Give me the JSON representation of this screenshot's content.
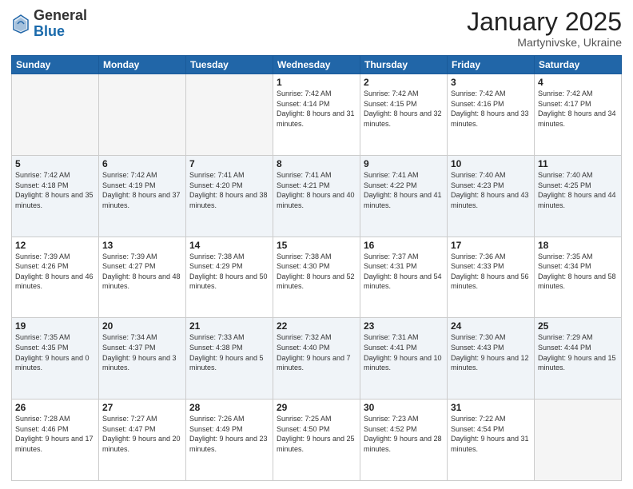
{
  "logo": {
    "general": "General",
    "blue": "Blue"
  },
  "title": "January 2025",
  "subtitle": "Martynivske, Ukraine",
  "days_header": [
    "Sunday",
    "Monday",
    "Tuesday",
    "Wednesday",
    "Thursday",
    "Friday",
    "Saturday"
  ],
  "weeks": [
    [
      {
        "day": "",
        "info": ""
      },
      {
        "day": "",
        "info": ""
      },
      {
        "day": "",
        "info": ""
      },
      {
        "day": "1",
        "info": "Sunrise: 7:42 AM\nSunset: 4:14 PM\nDaylight: 8 hours and 31 minutes."
      },
      {
        "day": "2",
        "info": "Sunrise: 7:42 AM\nSunset: 4:15 PM\nDaylight: 8 hours and 32 minutes."
      },
      {
        "day": "3",
        "info": "Sunrise: 7:42 AM\nSunset: 4:16 PM\nDaylight: 8 hours and 33 minutes."
      },
      {
        "day": "4",
        "info": "Sunrise: 7:42 AM\nSunset: 4:17 PM\nDaylight: 8 hours and 34 minutes."
      }
    ],
    [
      {
        "day": "5",
        "info": "Sunrise: 7:42 AM\nSunset: 4:18 PM\nDaylight: 8 hours and 35 minutes."
      },
      {
        "day": "6",
        "info": "Sunrise: 7:42 AM\nSunset: 4:19 PM\nDaylight: 8 hours and 37 minutes."
      },
      {
        "day": "7",
        "info": "Sunrise: 7:41 AM\nSunset: 4:20 PM\nDaylight: 8 hours and 38 minutes."
      },
      {
        "day": "8",
        "info": "Sunrise: 7:41 AM\nSunset: 4:21 PM\nDaylight: 8 hours and 40 minutes."
      },
      {
        "day": "9",
        "info": "Sunrise: 7:41 AM\nSunset: 4:22 PM\nDaylight: 8 hours and 41 minutes."
      },
      {
        "day": "10",
        "info": "Sunrise: 7:40 AM\nSunset: 4:23 PM\nDaylight: 8 hours and 43 minutes."
      },
      {
        "day": "11",
        "info": "Sunrise: 7:40 AM\nSunset: 4:25 PM\nDaylight: 8 hours and 44 minutes."
      }
    ],
    [
      {
        "day": "12",
        "info": "Sunrise: 7:39 AM\nSunset: 4:26 PM\nDaylight: 8 hours and 46 minutes."
      },
      {
        "day": "13",
        "info": "Sunrise: 7:39 AM\nSunset: 4:27 PM\nDaylight: 8 hours and 48 minutes."
      },
      {
        "day": "14",
        "info": "Sunrise: 7:38 AM\nSunset: 4:29 PM\nDaylight: 8 hours and 50 minutes."
      },
      {
        "day": "15",
        "info": "Sunrise: 7:38 AM\nSunset: 4:30 PM\nDaylight: 8 hours and 52 minutes."
      },
      {
        "day": "16",
        "info": "Sunrise: 7:37 AM\nSunset: 4:31 PM\nDaylight: 8 hours and 54 minutes."
      },
      {
        "day": "17",
        "info": "Sunrise: 7:36 AM\nSunset: 4:33 PM\nDaylight: 8 hours and 56 minutes."
      },
      {
        "day": "18",
        "info": "Sunrise: 7:35 AM\nSunset: 4:34 PM\nDaylight: 8 hours and 58 minutes."
      }
    ],
    [
      {
        "day": "19",
        "info": "Sunrise: 7:35 AM\nSunset: 4:35 PM\nDaylight: 9 hours and 0 minutes."
      },
      {
        "day": "20",
        "info": "Sunrise: 7:34 AM\nSunset: 4:37 PM\nDaylight: 9 hours and 3 minutes."
      },
      {
        "day": "21",
        "info": "Sunrise: 7:33 AM\nSunset: 4:38 PM\nDaylight: 9 hours and 5 minutes."
      },
      {
        "day": "22",
        "info": "Sunrise: 7:32 AM\nSunset: 4:40 PM\nDaylight: 9 hours and 7 minutes."
      },
      {
        "day": "23",
        "info": "Sunrise: 7:31 AM\nSunset: 4:41 PM\nDaylight: 9 hours and 10 minutes."
      },
      {
        "day": "24",
        "info": "Sunrise: 7:30 AM\nSunset: 4:43 PM\nDaylight: 9 hours and 12 minutes."
      },
      {
        "day": "25",
        "info": "Sunrise: 7:29 AM\nSunset: 4:44 PM\nDaylight: 9 hours and 15 minutes."
      }
    ],
    [
      {
        "day": "26",
        "info": "Sunrise: 7:28 AM\nSunset: 4:46 PM\nDaylight: 9 hours and 17 minutes."
      },
      {
        "day": "27",
        "info": "Sunrise: 7:27 AM\nSunset: 4:47 PM\nDaylight: 9 hours and 20 minutes."
      },
      {
        "day": "28",
        "info": "Sunrise: 7:26 AM\nSunset: 4:49 PM\nDaylight: 9 hours and 23 minutes."
      },
      {
        "day": "29",
        "info": "Sunrise: 7:25 AM\nSunset: 4:50 PM\nDaylight: 9 hours and 25 minutes."
      },
      {
        "day": "30",
        "info": "Sunrise: 7:23 AM\nSunset: 4:52 PM\nDaylight: 9 hours and 28 minutes."
      },
      {
        "day": "31",
        "info": "Sunrise: 7:22 AM\nSunset: 4:54 PM\nDaylight: 9 hours and 31 minutes."
      },
      {
        "day": "",
        "info": ""
      }
    ]
  ]
}
